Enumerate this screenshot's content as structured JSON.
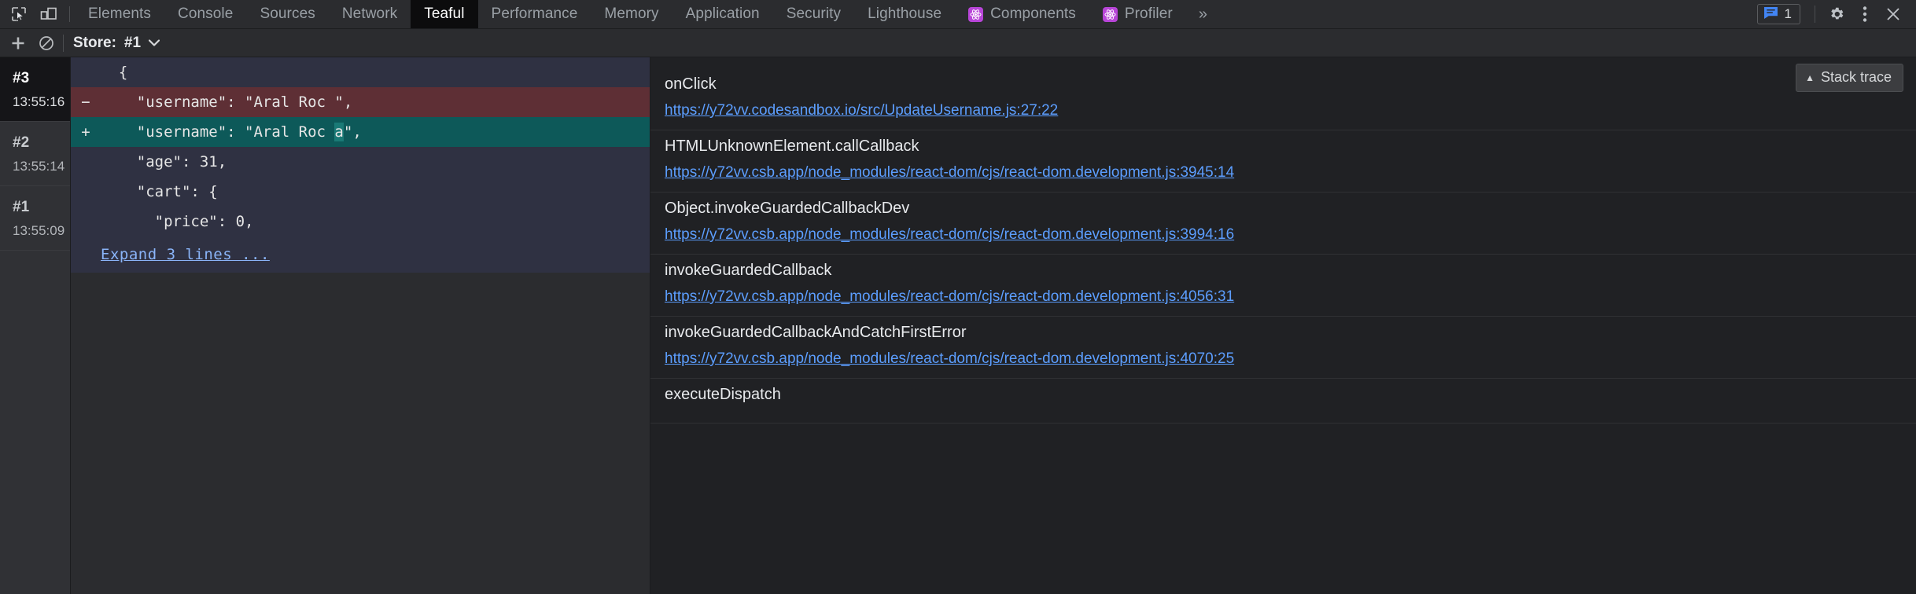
{
  "devtools": {
    "toolbar_icons": [
      {
        "name": "inspect-element-icon",
        "label": "Inspect element"
      },
      {
        "name": "device-toolbar-icon",
        "label": "Toggle device toolbar"
      }
    ],
    "tabs": [
      {
        "label": "Elements",
        "active": false,
        "icon": null
      },
      {
        "label": "Console",
        "active": false,
        "icon": null
      },
      {
        "label": "Sources",
        "active": false,
        "icon": null
      },
      {
        "label": "Network",
        "active": false,
        "icon": null
      },
      {
        "label": "Teaful",
        "active": true,
        "icon": null
      },
      {
        "label": "Performance",
        "active": false,
        "icon": null
      },
      {
        "label": "Memory",
        "active": false,
        "icon": null
      },
      {
        "label": "Application",
        "active": false,
        "icon": null
      },
      {
        "label": "Security",
        "active": false,
        "icon": null
      },
      {
        "label": "Lighthouse",
        "active": false,
        "icon": null
      },
      {
        "label": "Components",
        "active": false,
        "icon": "react-atom-icon"
      },
      {
        "label": "Profiler",
        "active": false,
        "icon": "react-atom-icon"
      }
    ],
    "more_tabs_label": "»",
    "messages": {
      "icon": "message-bubble-icon",
      "count": "1"
    },
    "settings_icon": "gear-icon",
    "menu_icon": "vertical-dots-icon",
    "close_icon": "close-icon",
    "accent_blue": "#4285f4",
    "react_purple": "#b845d8"
  },
  "panel_toolbar": {
    "add_icon": "plus-icon",
    "clear_icon": "clear-prohibited-icon",
    "store_label": "Store:",
    "store_value": "#1",
    "store_chevron": "⌄"
  },
  "actions": [
    {
      "id": "#3",
      "time": "13:55:16",
      "selected": true
    },
    {
      "id": "#2",
      "time": "13:55:14",
      "selected": false
    },
    {
      "id": "#1",
      "time": "13:55:09",
      "selected": false
    }
  ],
  "diff": {
    "lines": [
      {
        "type": "context",
        "mark": "",
        "text": "  {"
      },
      {
        "type": "del",
        "mark": "−",
        "text": "    \"username\": \"Aral Roc \","
      },
      {
        "type": "add",
        "mark": "+",
        "pre": "    \"username\": \"Aral Roc ",
        "highlight": "a",
        "post": "\","
      },
      {
        "type": "context",
        "mark": "",
        "text": "    \"age\": 31,"
      },
      {
        "type": "context",
        "mark": "",
        "text": "    \"cart\": {"
      },
      {
        "type": "context",
        "mark": "",
        "text": "      \"price\": 0,"
      }
    ],
    "expand_label": "Expand 3 lines ...",
    "colors": {
      "del_bg": "#5e2f35",
      "add_bg": "#0d5959",
      "context_bg": "#2f3142",
      "highlight_bg": "#1a7a76"
    }
  },
  "stack_trace": {
    "button_label": "Stack trace",
    "button_icon": "triangle-up-icon",
    "frames": [
      {
        "name": "onClick",
        "url": "https://y72vv.codesandbox.io/src/UpdateUsername.js:27:22"
      },
      {
        "name": "HTMLUnknownElement.callCallback",
        "url": "https://y72vv.csb.app/node_modules/react-dom/cjs/react-dom.development.js:3945:14"
      },
      {
        "name": "Object.invokeGuardedCallbackDev",
        "url": "https://y72vv.csb.app/node_modules/react-dom/cjs/react-dom.development.js:3994:16"
      },
      {
        "name": "invokeGuardedCallback",
        "url": "https://y72vv.csb.app/node_modules/react-dom/cjs/react-dom.development.js:4056:31"
      },
      {
        "name": "invokeGuardedCallbackAndCatchFirstError",
        "url": "https://y72vv.csb.app/node_modules/react-dom/cjs/react-dom.development.js:4070:25"
      },
      {
        "name": "executeDispatch",
        "url": ""
      }
    ]
  }
}
